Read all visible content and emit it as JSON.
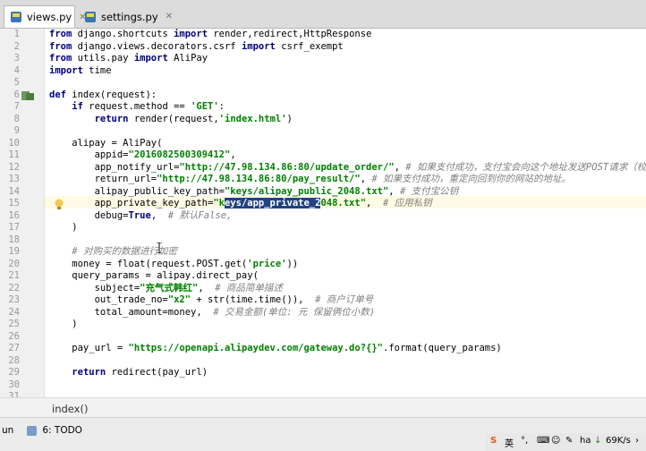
{
  "tabs": [
    {
      "label": "views.py",
      "active": true
    },
    {
      "label": "settings.py",
      "active": false
    }
  ],
  "editor": {
    "current_line": 15,
    "selection": "eys/app_private_2",
    "lines": [
      {
        "n": "1",
        "t": "from django.shortcuts import render,redirect,HttpResponse"
      },
      {
        "n": "2",
        "t": "from django.views.decorators.csrf import csrf_exempt"
      },
      {
        "n": "3",
        "t": "from utils.pay import AliPay"
      },
      {
        "n": "4",
        "t": "import time"
      },
      {
        "n": "5",
        "t": ""
      },
      {
        "n": "6",
        "t": "def index(request):"
      },
      {
        "n": "7",
        "t": "    if request.method == 'GET':"
      },
      {
        "n": "8",
        "t": "        return render(request,'index.html')"
      },
      {
        "n": "9",
        "t": ""
      },
      {
        "n": "10",
        "t": "    alipay = AliPay("
      },
      {
        "n": "11",
        "t": "        appid=\"2016082500309412\","
      },
      {
        "n": "12",
        "t": "        app_notify_url=\"http://47.98.134.86:80/update_order/\", # 如果支付成功，支付宝会向这个地址发送POST请求（校验是否"
      },
      {
        "n": "13",
        "t": "        return_url=\"http://47.98.134.86:80/pay_result/\", # 如果支付成功，重定向回到你的网站的地址。"
      },
      {
        "n": "14",
        "t": "        alipay_public_key_path=\"keys/alipay_public_2048.txt\", # 支付宝公钥"
      },
      {
        "n": "15",
        "t": "        app_private_key_path=\"keys/app_private_2048.txt\",  # 应用私钥"
      },
      {
        "n": "16",
        "t": "        debug=True,  # 默认False,"
      },
      {
        "n": "17",
        "t": "    )"
      },
      {
        "n": "18",
        "t": ""
      },
      {
        "n": "19",
        "t": "    # 对购买的数据进行加密"
      },
      {
        "n": "20",
        "t": "    money = float(request.POST.get('price'))"
      },
      {
        "n": "21",
        "t": "    query_params = alipay.direct_pay("
      },
      {
        "n": "22",
        "t": "        subject=\"充气式韩红\",  # 商品简单描述"
      },
      {
        "n": "23",
        "t": "        out_trade_no=\"x2\" + str(time.time()),  # 商户订单号"
      },
      {
        "n": "24",
        "t": "        total_amount=money,  # 交易金额(单位: 元 保留俩位小数)"
      },
      {
        "n": "25",
        "t": "    )"
      },
      {
        "n": "26",
        "t": ""
      },
      {
        "n": "27",
        "t": "    pay_url = \"https://openapi.alipaydev.com/gateway.do?{}\".format(query_params)"
      },
      {
        "n": "28",
        "t": ""
      },
      {
        "n": "29",
        "t": "    return redirect(pay_url)"
      },
      {
        "n": "30",
        "t": ""
      },
      {
        "n": "31",
        "t": ""
      }
    ]
  },
  "breadcrumb": "index()",
  "bottom": {
    "run_label": "un",
    "todo_label": "6: TODO"
  },
  "taskbar": {
    "ime": "英",
    "text": "ha",
    "speed": "69K/s"
  },
  "colors": {
    "keyword": "#000080",
    "string": "#008000",
    "comment": "#808080",
    "current_line": "#fffae3",
    "selection": "#214283"
  }
}
